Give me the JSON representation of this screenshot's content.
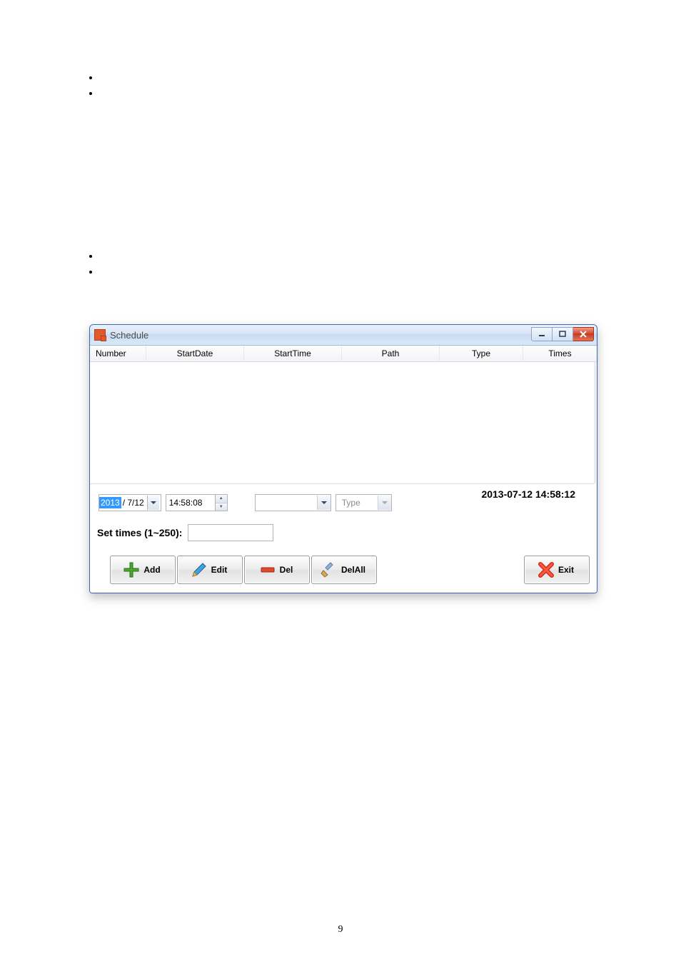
{
  "page_number": "9",
  "window": {
    "title": "Schedule"
  },
  "columns": {
    "number": "Number",
    "startdate": "StartDate",
    "starttime": "StartTime",
    "path": "Path",
    "type": "Type",
    "times": "Times"
  },
  "clock": "2013-07-12 14:58:12",
  "date_picker": {
    "selected_year": "2013",
    "remainder": "/ 7/12"
  },
  "time_spinner": {
    "value": "14:58:08"
  },
  "path_combo": {
    "value": ""
  },
  "type_combo": {
    "value": "Type"
  },
  "set_times": {
    "label": "Set times (1~250):",
    "value": ""
  },
  "buttons": {
    "add": "Add",
    "edit": "Edit",
    "del": "Del",
    "delall": "DelAll",
    "exit": "Exit"
  }
}
